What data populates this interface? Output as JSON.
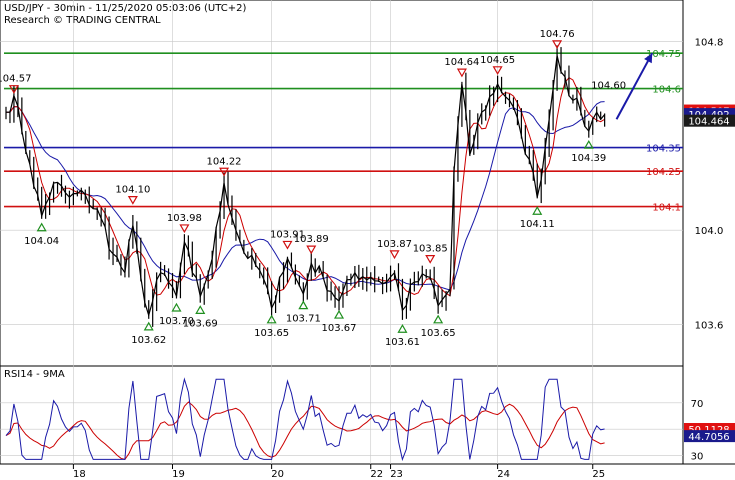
{
  "chart_data": {
    "type": "line",
    "title": "USD/JPY - 30min - 11/25/2020 05:03:06 (UTC+2)",
    "subtitle": "Research © TRADING CENTRAL",
    "price_ylim": [
      103.45,
      104.95
    ],
    "price_ticks": [
      {
        "value": 104.8,
        "label": "104.8"
      },
      {
        "value": 104.0,
        "label": "104.0"
      },
      {
        "value": 103.6,
        "label": "103.6"
      }
    ],
    "x_ticks": [
      "18",
      "19",
      "20",
      "22",
      "23",
      "24",
      "25"
    ],
    "x_tick_index": [
      17,
      42,
      67,
      92,
      97,
      124,
      148
    ],
    "levels": [
      {
        "value": 104.75,
        "label": "104.75",
        "color": "#1f8f1f"
      },
      {
        "value": 104.6,
        "label": "104.6",
        "color": "#1f8f1f"
      },
      {
        "value": 104.35,
        "label": "104.35",
        "color": "#1a1aa8"
      },
      {
        "value": 104.25,
        "label": "104.25",
        "color": "#d01010"
      },
      {
        "value": 104.1,
        "label": "104.1",
        "color": "#d01010"
      }
    ],
    "current_prices": [
      {
        "value": 104.507,
        "label": "104.507",
        "bg": "#e01010",
        "fg": "#ffffff"
      },
      {
        "value": 104.492,
        "label": "104.492",
        "bg": "#1a1a8c",
        "fg": "#ffffff"
      },
      {
        "value": 104.464,
        "label": "104.464",
        "bg": "#1a1a1a",
        "fg": "#ffffff"
      }
    ],
    "annotations": [
      {
        "kind": "high",
        "i": 2,
        "v": 104.57,
        "label": "104.57"
      },
      {
        "kind": "low",
        "i": 9,
        "v": 104.04,
        "label": "104.04"
      },
      {
        "kind": "high",
        "i": 32,
        "v": 104.1,
        "label": "104.10"
      },
      {
        "kind": "low",
        "i": 36,
        "v": 103.62,
        "label": "103.62"
      },
      {
        "kind": "low",
        "i": 43,
        "v": 103.7,
        "label": "103.70"
      },
      {
        "kind": "high",
        "i": 45,
        "v": 103.98,
        "label": "103.98"
      },
      {
        "kind": "low",
        "i": 49,
        "v": 103.69,
        "label": "103.69"
      },
      {
        "kind": "high",
        "i": 55,
        "v": 104.22,
        "label": "104.22"
      },
      {
        "kind": "low",
        "i": 67,
        "v": 103.65,
        "label": "103.65"
      },
      {
        "kind": "high",
        "i": 71,
        "v": 103.91,
        "label": "103.91"
      },
      {
        "kind": "low",
        "i": 75,
        "v": 103.71,
        "label": "103.71"
      },
      {
        "kind": "high",
        "i": 77,
        "v": 103.89,
        "label": "103.89"
      },
      {
        "kind": "low",
        "i": 84,
        "v": 103.67,
        "label": "103.67"
      },
      {
        "kind": "high",
        "i": 98,
        "v": 103.87,
        "label": "103.87"
      },
      {
        "kind": "low",
        "i": 100,
        "v": 103.61,
        "label": "103.61"
      },
      {
        "kind": "high",
        "i": 107,
        "v": 103.85,
        "label": "103.85"
      },
      {
        "kind": "low",
        "i": 109,
        "v": 103.65,
        "label": "103.65"
      },
      {
        "kind": "high",
        "i": 115,
        "v": 104.64,
        "label": "104.64"
      },
      {
        "kind": "high",
        "i": 124,
        "v": 104.65,
        "label": "104.65"
      },
      {
        "kind": "low",
        "i": 134,
        "v": 104.11,
        "label": "104.11"
      },
      {
        "kind": "high",
        "i": 139,
        "v": 104.76,
        "label": "104.76"
      },
      {
        "kind": "low",
        "i": 147,
        "v": 104.39,
        "label": "104.39"
      },
      {
        "kind": "text",
        "i": 152,
        "v": 104.6,
        "label": "104.60"
      }
    ],
    "arrow": {
      "from_i": 154,
      "from_v": 104.47,
      "to_i": 163,
      "to_v": 104.75,
      "color": "#1a1aa8"
    },
    "n_bars": 152,
    "price_anchors": [
      [
        0,
        104.5
      ],
      [
        2,
        104.57
      ],
      [
        4,
        104.42
      ],
      [
        6,
        104.28
      ],
      [
        9,
        104.06
      ],
      [
        12,
        104.2
      ],
      [
        16,
        104.14
      ],
      [
        20,
        104.15
      ],
      [
        24,
        104.05
      ],
      [
        27,
        103.9
      ],
      [
        30,
        103.82
      ],
      [
        32,
        104.02
      ],
      [
        34,
        103.8
      ],
      [
        36,
        103.64
      ],
      [
        39,
        103.82
      ],
      [
        41,
        103.78
      ],
      [
        43,
        103.72
      ],
      [
        45,
        103.95
      ],
      [
        47,
        103.82
      ],
      [
        49,
        103.72
      ],
      [
        52,
        103.88
      ],
      [
        55,
        104.2
      ],
      [
        58,
        104.0
      ],
      [
        61,
        103.88
      ],
      [
        64,
        103.83
      ],
      [
        67,
        103.67
      ],
      [
        69,
        103.8
      ],
      [
        71,
        103.88
      ],
      [
        73,
        103.8
      ],
      [
        75,
        103.73
      ],
      [
        77,
        103.86
      ],
      [
        80,
        103.8
      ],
      [
        84,
        103.7
      ],
      [
        88,
        103.82
      ],
      [
        92,
        103.8
      ],
      [
        96,
        103.78
      ],
      [
        98,
        103.82
      ],
      [
        100,
        103.66
      ],
      [
        103,
        103.78
      ],
      [
        107,
        103.8
      ],
      [
        109,
        103.68
      ],
      [
        112,
        103.75
      ],
      [
        113,
        104.25
      ],
      [
        115,
        104.62
      ],
      [
        117,
        104.32
      ],
      [
        120,
        104.5
      ],
      [
        124,
        104.62
      ],
      [
        127,
        104.55
      ],
      [
        130,
        104.4
      ],
      [
        132,
        104.3
      ],
      [
        134,
        104.14
      ],
      [
        136,
        104.35
      ],
      [
        138,
        104.6
      ],
      [
        139,
        104.74
      ],
      [
        141,
        104.65
      ],
      [
        143,
        104.55
      ],
      [
        145,
        104.5
      ],
      [
        147,
        104.42
      ],
      [
        149,
        104.5
      ],
      [
        151,
        104.49
      ]
    ],
    "rsi": {
      "label": "RSI14 - 9MA",
      "ylim": [
        25,
        95
      ],
      "ticks": [
        {
          "value": 70,
          "label": "70"
        },
        {
          "value": 30,
          "label": "30"
        }
      ],
      "guide_levels": [
        70,
        50,
        30
      ],
      "current": [
        {
          "value": 50.1,
          "label": "50.1128",
          "bg": "#e01010",
          "fg": "#ffffff"
        },
        {
          "value": 44.7,
          "label": "44.7056",
          "bg": "#1a1a8c",
          "fg": "#ffffff"
        }
      ]
    },
    "colors": {
      "price": "#000000",
      "ma_fast": "#cc0000",
      "ma_slow": "#1a1aa8",
      "high_marker": "#d01010",
      "low_marker": "#1f8f1f",
      "grid": "#c8c8c8",
      "panel_border": "#000000"
    }
  }
}
